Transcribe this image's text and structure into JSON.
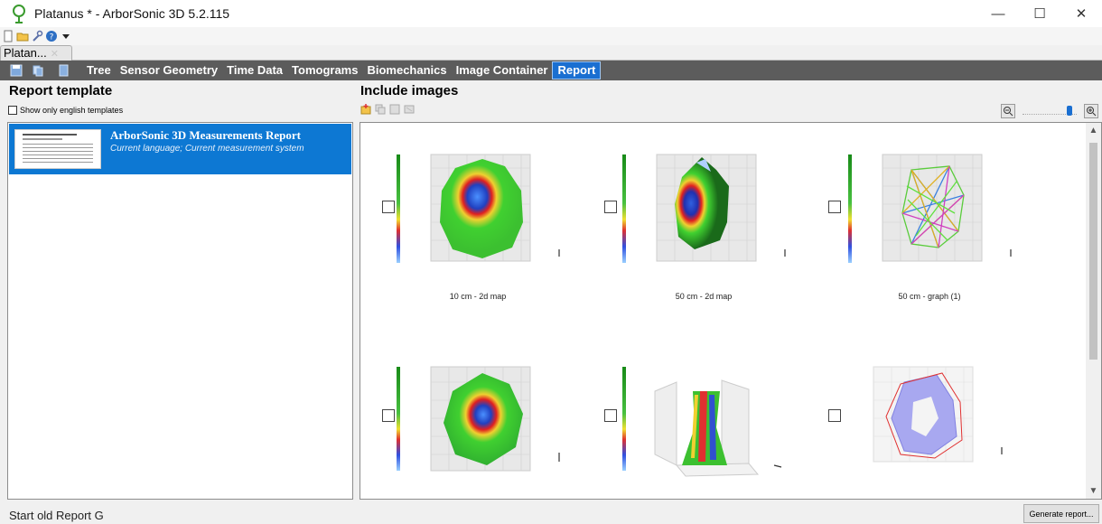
{
  "window": {
    "title": "Platanus * - ArborSonic 3D 5.2.115",
    "minimize_glyph": "—",
    "maximize_glyph": "☐",
    "close_glyph": "✕"
  },
  "document_tab": {
    "label": "Platan...",
    "close_glyph": "✕"
  },
  "menu": {
    "items": [
      "Tree",
      "Sensor Geometry",
      "Time Data",
      "Tomograms",
      "Biomechanics",
      "Image Container",
      "Report"
    ],
    "active_index": 6,
    "active_color": "#1a6fd1"
  },
  "left": {
    "heading": "Report template",
    "checkbox_label": "Show only english templates",
    "checkbox_checked": false,
    "templates": [
      {
        "title": "ArborSonic 3D Measurements Report",
        "subtitle": "Current language; Current measurement system",
        "selected": true
      }
    ]
  },
  "right": {
    "heading": "Include images",
    "toolbar_icons": [
      "add-image-icon",
      "copy-image-icon",
      "save-image-icon",
      "delete-image-icon"
    ],
    "zoom_level": 0.9,
    "images": [
      {
        "caption": "10 cm - 2d map",
        "kind": "2d-map",
        "checked": false
      },
      {
        "caption": "50 cm - 2d map",
        "kind": "2d-map",
        "checked": false
      },
      {
        "caption": "50 cm - graph (1)",
        "kind": "graph",
        "checked": false
      },
      {
        "caption": "",
        "kind": "2d-map",
        "checked": false
      },
      {
        "caption": "",
        "kind": "3d-view",
        "checked": false
      },
      {
        "caption": "",
        "kind": "outline",
        "checked": false
      }
    ]
  },
  "status": {
    "text": "Start old Report G"
  },
  "generate_button": {
    "label": "Generate report..."
  }
}
